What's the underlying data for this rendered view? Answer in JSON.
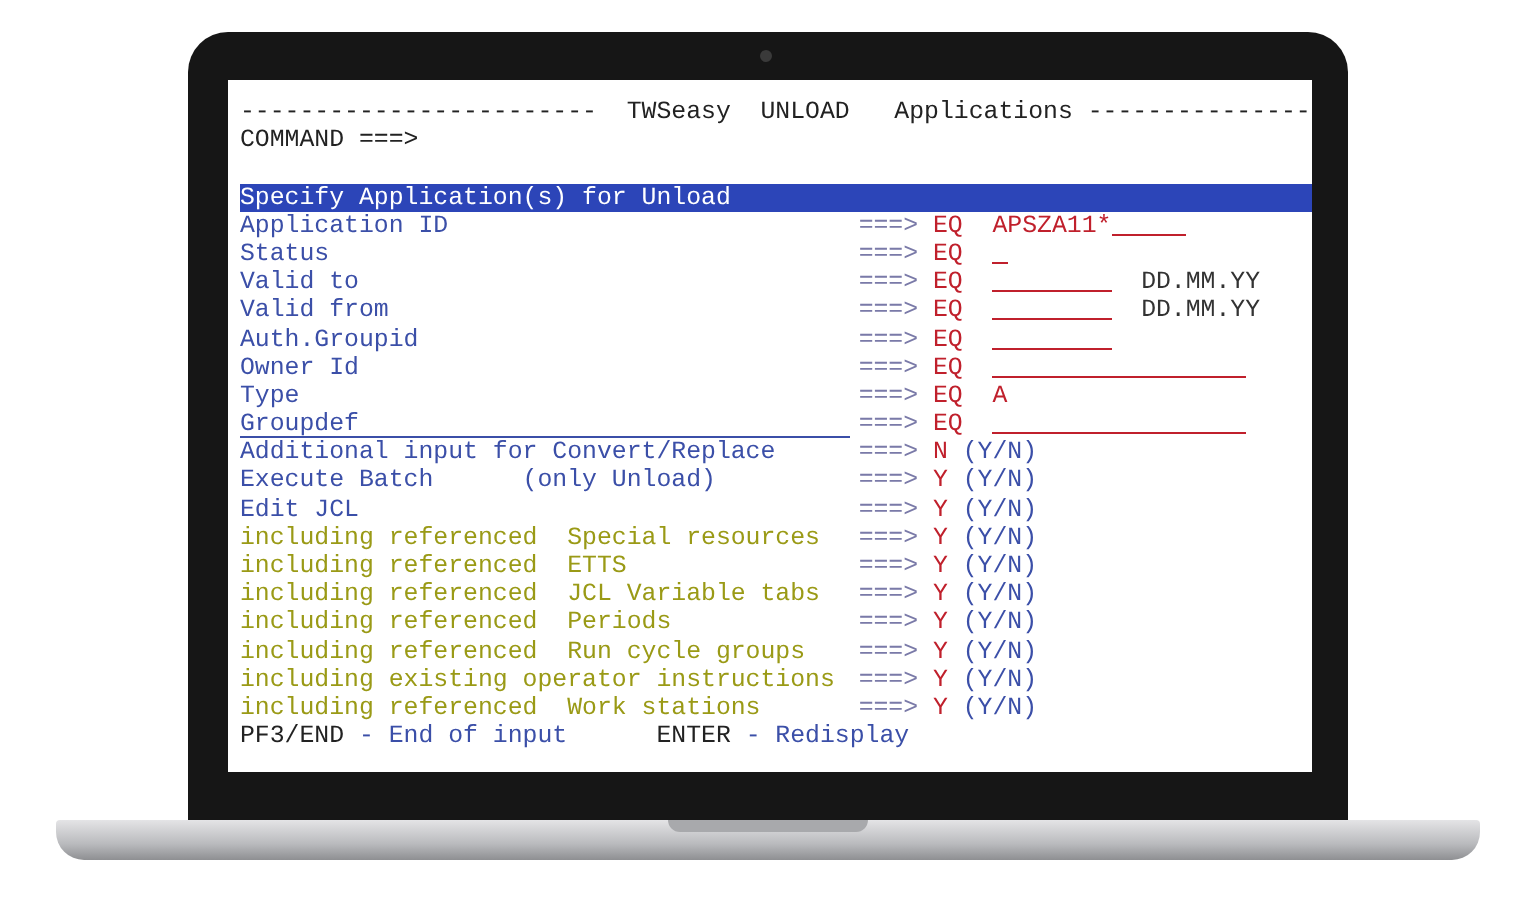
{
  "header": {
    "dashes_left": "------------------------",
    "product": "TWSeasy",
    "function": "UNLOAD",
    "object": "Applications",
    "dashes_right": "---------------"
  },
  "command": {
    "label": "COMMAND ===>"
  },
  "section_title": "Specify Application(s) for Unload",
  "fields": [
    {
      "label": "Application ID",
      "arrow": "===>",
      "operator": "EQ",
      "kind": "key",
      "value": "APSZA11*"
    },
    {
      "label": "Status",
      "arrow": "===>",
      "operator": "EQ",
      "kind": "flag"
    },
    {
      "label": "Valid to",
      "arrow": "===>",
      "operator": "EQ",
      "kind": "date",
      "hint": "DD.MM.YY"
    },
    {
      "label": "Valid from",
      "arrow": "===>",
      "operator": "EQ",
      "kind": "date",
      "hint": "DD.MM.YY"
    },
    {
      "label": "Auth.Groupid",
      "arrow": "===>",
      "operator": "EQ",
      "kind": "date"
    },
    {
      "label": "Owner Id",
      "arrow": "===>",
      "operator": "EQ",
      "kind": "name"
    },
    {
      "label": "Type",
      "arrow": "===>",
      "operator": "EQ",
      "kind": "flag",
      "value": "A"
    },
    {
      "label": "Groupdef",
      "arrow": "===>",
      "operator": "EQ",
      "kind": "name"
    }
  ],
  "options": [
    {
      "label": "Additional input for Convert/Replace",
      "kind": "main",
      "arrow": "===>",
      "value": "N",
      "hint": "(Y/N)"
    },
    {
      "label": "Execute Batch      (only Unload)",
      "kind": "main",
      "arrow": "===>",
      "value": "Y",
      "hint": "(Y/N)"
    },
    {
      "label": "Edit JCL",
      "kind": "main",
      "arrow": "===>",
      "value": "Y",
      "hint": "(Y/N)"
    },
    {
      "label": "including referenced  Special resources",
      "kind": "referenced",
      "arrow": "===>",
      "value": "Y",
      "hint": "(Y/N)"
    },
    {
      "label": "including referenced  ETTS",
      "kind": "referenced",
      "arrow": "===>",
      "value": "Y",
      "hint": "(Y/N)"
    },
    {
      "label": "including referenced  JCL Variable tabs",
      "kind": "referenced",
      "arrow": "===>",
      "value": "Y",
      "hint": "(Y/N)"
    },
    {
      "label": "including referenced  Periods",
      "kind": "referenced",
      "arrow": "===>",
      "value": "Y",
      "hint": "(Y/N)"
    },
    {
      "label": "including referenced  Run cycle groups",
      "kind": "referenced",
      "arrow": "===>",
      "value": "Y",
      "hint": "(Y/N)"
    },
    {
      "label": "including existing operator instructions",
      "kind": "referenced",
      "arrow": "===>",
      "value": "Y",
      "hint": "(Y/N)"
    },
    {
      "label": "including referenced  Work stations",
      "kind": "referenced",
      "arrow": "===>",
      "value": "Y",
      "hint": "(Y/N)"
    }
  ],
  "footer": [
    {
      "key": "PF3/END",
      "action": "- End of input"
    },
    {
      "key": "ENTER",
      "action": "- Redisplay"
    }
  ]
}
